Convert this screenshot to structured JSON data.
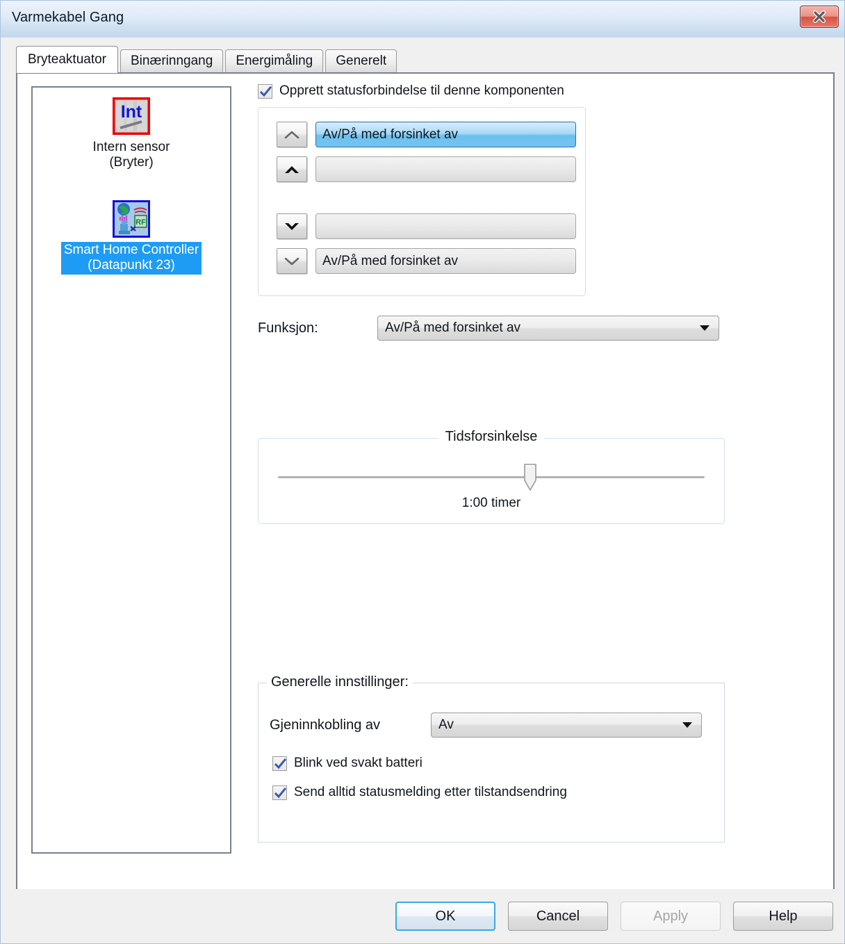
{
  "window": {
    "title": "Varmekabel Gang",
    "close_icon": "close-icon"
  },
  "tabs": [
    {
      "label": "Bryteaktuator",
      "active": true
    },
    {
      "label": "Binærinngang",
      "active": false
    },
    {
      "label": "Energimåling",
      "active": false
    },
    {
      "label": "Generelt",
      "active": false
    }
  ],
  "component_list": [
    {
      "icon": "internal-sensor-icon",
      "label": "Intern sensor\n(Bryter)",
      "selected": false
    },
    {
      "icon": "rf-controller-icon",
      "label": "Smart Home Controller\n(Datapunkt 23)",
      "selected": true
    }
  ],
  "status_checkbox": {
    "label": "Opprett statusforbindelse til denne komponenten",
    "checked": true
  },
  "channel_rows": [
    {
      "arrow": "chevron-up-thin-icon",
      "value": "Av/På med forsinket av",
      "selected": true
    },
    {
      "arrow": "chevron-up-bold-icon",
      "value": "",
      "selected": false
    },
    {
      "arrow": "chevron-down-bold-icon",
      "value": "",
      "selected": false
    },
    {
      "arrow": "chevron-down-thin-icon",
      "value": "Av/På med forsinket av",
      "selected": false
    }
  ],
  "function": {
    "label": "Funksjon:",
    "value": "Av/På med forsinket av",
    "caret_icon": "chevron-down-icon"
  },
  "time_delay": {
    "legend": "Tidsforsinkelse",
    "value_text": "1:00 timer",
    "thumb_percent": 59
  },
  "general_settings": {
    "legend": "Generelle innstillinger:",
    "reclose_label": "Gjeninnkobling av",
    "reclose_value": "Av",
    "caret_icon": "chevron-down-icon",
    "checkbox_battery": {
      "label": "Blink ved svakt batteri",
      "checked": true
    },
    "checkbox_status": {
      "label": "Send alltid statusmelding etter tilstandsendring",
      "checked": true
    }
  },
  "footer_buttons": [
    {
      "label": "OK",
      "state": "default"
    },
    {
      "label": "Cancel",
      "state": "normal"
    },
    {
      "label": "Apply",
      "state": "disabled"
    },
    {
      "label": "Help",
      "state": "normal"
    }
  ],
  "colors": {
    "selection_blue": "#1e9cf5",
    "field_selected": "#74c3f0",
    "accent_close": "#d9503e",
    "checkmark_blue": "#3a5ba8"
  }
}
